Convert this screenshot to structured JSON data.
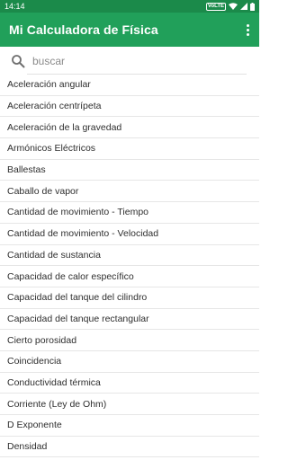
{
  "status_bar": {
    "time": "14:14",
    "badge": "VoLTE",
    "icons": [
      "wifi-icon",
      "signal-icon",
      "battery-icon"
    ]
  },
  "app_bar": {
    "title": "Mi Calculadora de Física",
    "menu_icon": "more-vert-icon"
  },
  "search": {
    "placeholder": "buscar",
    "value": ""
  },
  "items": [
    "Aceleración angular",
    "Aceleración centrípeta",
    "Aceleración de la gravedad",
    "Armónicos Eléctricos",
    "Ballestas",
    "Caballo de vapor",
    "Cantidad de movimiento - Tiempo",
    "Cantidad de movimiento - Velocidad",
    "Cantidad de sustancia",
    "Capacidad de calor específico",
    "Capacidad del tanque del cilindro",
    "Capacidad del tanque rectangular",
    "Cierto porosidad",
    "Coincidencia",
    "Conductividad térmica",
    "Corriente (Ley de Ohm)",
    "D Exponente",
    "Densidad"
  ],
  "colors": {
    "status_bar": "#1b8a4a",
    "app_bar": "#21a05a",
    "text": "#2e2e2e",
    "divider": "#e6e6e6"
  }
}
